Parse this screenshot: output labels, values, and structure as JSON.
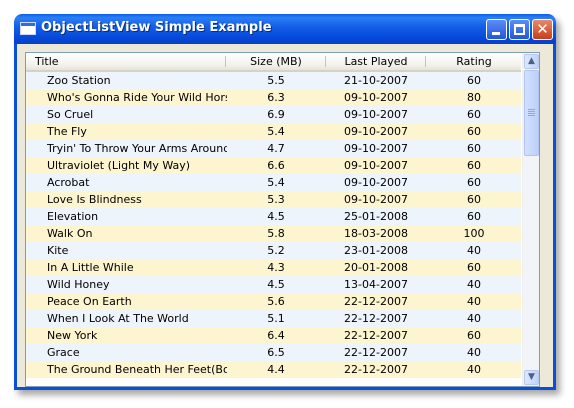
{
  "window": {
    "title": "ObjectListView Simple Example",
    "minimize_glyph": "",
    "maximize_glyph": "",
    "close_glyph": "✕"
  },
  "columns": [
    "Title",
    "Size (MB)",
    "Last Played",
    "Rating"
  ],
  "rows": [
    [
      "Zoo Station",
      "5.5",
      "21-10-2007",
      "60"
    ],
    [
      "Who's Gonna Ride Your Wild Horses",
      "6.3",
      "09-10-2007",
      "80"
    ],
    [
      "So Cruel",
      "6.9",
      "09-10-2007",
      "60"
    ],
    [
      "The Fly",
      "5.4",
      "09-10-2007",
      "60"
    ],
    [
      "Tryin' To Throw Your Arms Around...",
      "4.7",
      "09-10-2007",
      "60"
    ],
    [
      "Ultraviolet (Light My Way)",
      "6.6",
      "09-10-2007",
      "60"
    ],
    [
      "Acrobat",
      "5.4",
      "09-10-2007",
      "60"
    ],
    [
      "Love Is Blindness",
      "5.3",
      "09-10-2007",
      "60"
    ],
    [
      "Elevation",
      "4.5",
      "25-01-2008",
      "60"
    ],
    [
      "Walk On",
      "5.8",
      "18-03-2008",
      "100"
    ],
    [
      "Kite",
      "5.2",
      "23-01-2008",
      "40"
    ],
    [
      "In A Little While",
      "4.3",
      "20-01-2008",
      "60"
    ],
    [
      "Wild Honey",
      "4.5",
      "13-04-2007",
      "40"
    ],
    [
      "Peace On Earth",
      "5.6",
      "22-12-2007",
      "40"
    ],
    [
      "When I Look At The World",
      "5.1",
      "22-12-2007",
      "40"
    ],
    [
      "New York",
      "6.4",
      "22-12-2007",
      "60"
    ],
    [
      "Grace",
      "6.5",
      "22-12-2007",
      "40"
    ],
    [
      "The Ground Beneath Her Feet(Bon...",
      "4.4",
      "22-12-2007",
      "40"
    ]
  ],
  "scrollbar": {
    "up_glyph": "▲",
    "down_glyph": "▼"
  }
}
